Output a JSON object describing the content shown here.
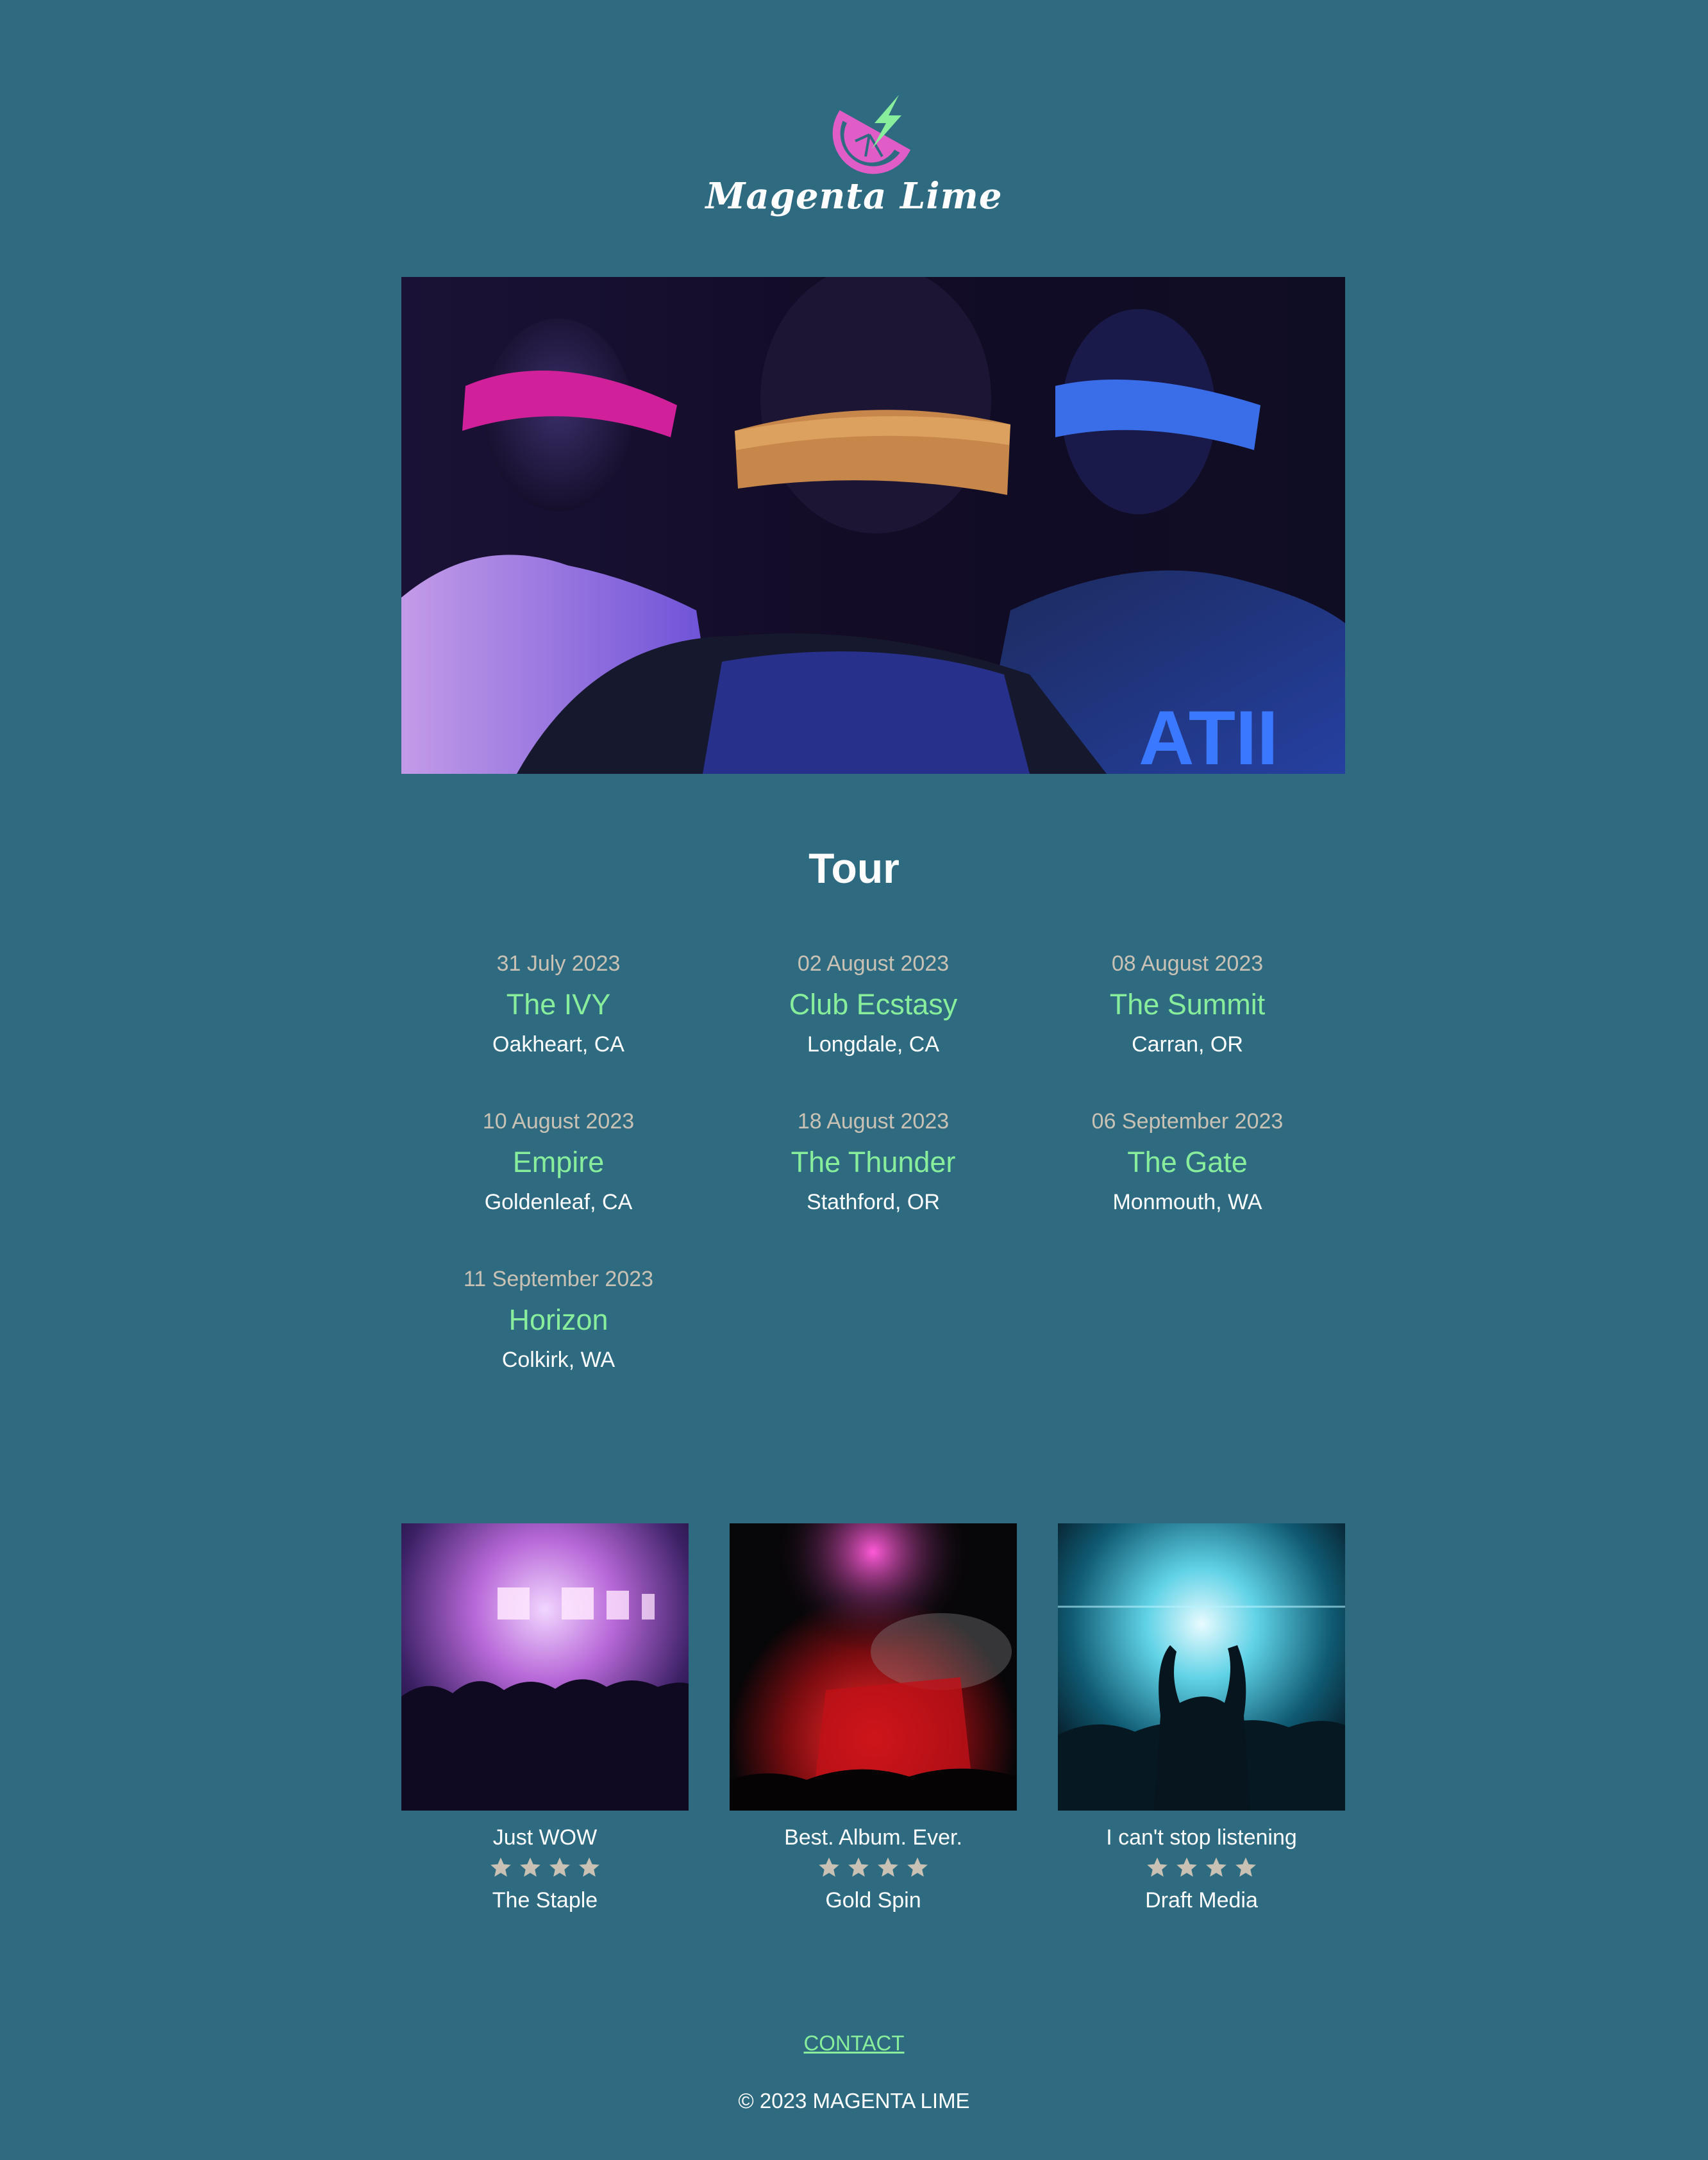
{
  "brand": {
    "name": "Magenta Lime",
    "colors": {
      "background": "#2e6b80",
      "accent_green": "#88ee9c",
      "accent_magenta": "#e05cc6",
      "date_text": "#c9c2b4",
      "star": "#c9c2b4"
    },
    "logo_icon": "citrus-slice-lightning-icon"
  },
  "hero": {
    "image": "band-members-blindfolded-photo"
  },
  "tour": {
    "title": "Tour",
    "events": [
      {
        "date": "31 July 2023",
        "venue": "The IVY",
        "city": "Oakheart, CA"
      },
      {
        "date": "02 August 2023",
        "venue": "Club Ecstasy",
        "city": "Longdale, CA"
      },
      {
        "date": "08 August 2023",
        "venue": "The Summit",
        "city": "Carran, OR"
      },
      {
        "date": "10 August 2023",
        "venue": "Empire",
        "city": "Goldenleaf, CA"
      },
      {
        "date": "18 August 2023",
        "venue": "The Thunder",
        "city": "Stathford, OR"
      },
      {
        "date": "06 September 2023",
        "venue": "The Gate",
        "city": "Monmouth, WA"
      },
      {
        "date": "11 September 2023",
        "venue": "Horizon",
        "city": "Colkirk, WA"
      }
    ]
  },
  "reviews": [
    {
      "image": "concert-purple-stage-photo",
      "quote": "Just WOW",
      "rating": 4,
      "source": "The Staple"
    },
    {
      "image": "concert-fireworks-photo",
      "quote": "Best. Album. Ever.",
      "rating": 4,
      "source": "Gold Spin"
    },
    {
      "image": "concert-blue-lights-photo",
      "quote": "I can't stop listening",
      "rating": 4,
      "source": "Draft Media"
    }
  ],
  "footer": {
    "contact_label": "CONTACT",
    "copyright": "© 2023 MAGENTA LIME"
  }
}
